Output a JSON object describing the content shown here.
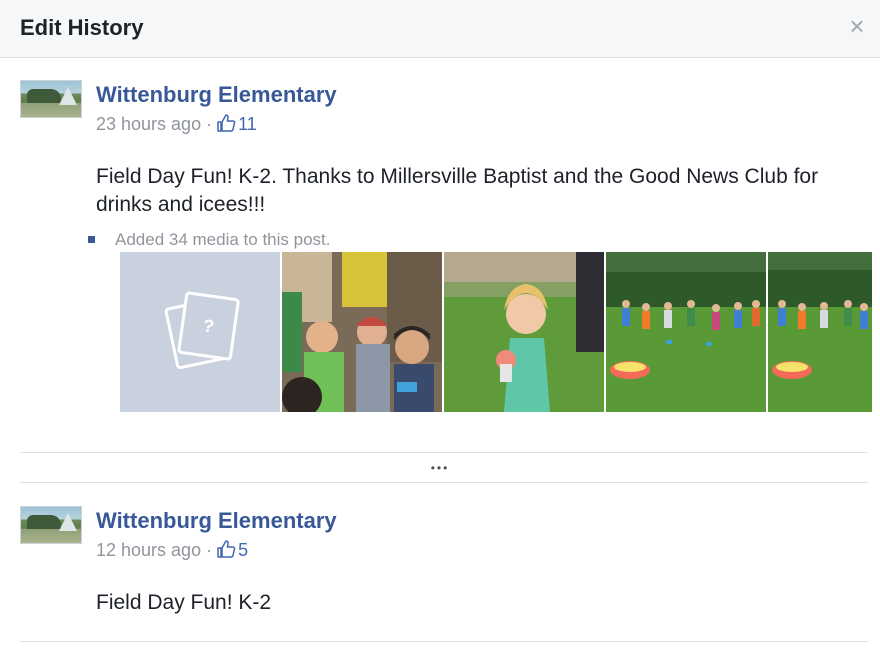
{
  "dialog": {
    "title": "Edit History",
    "close_icon": "close-icon"
  },
  "revisions": [
    {
      "author": "Wittenburg Elementary",
      "time": "23 hours ago",
      "separator": "·",
      "likes": "11",
      "text": "Field Day Fun! K-2. Thanks to Millersville Baptist and the Good News Club for drinks and icees!!!",
      "media_note": "Added 34 media to this post."
    },
    {
      "author": "Wittenburg Elementary",
      "time": "12 hours ago",
      "separator": "·",
      "likes": "5",
      "text": "Field Day Fun! K-2"
    }
  ],
  "more_indicator": "•••",
  "colors": {
    "link_blue": "#385898",
    "like_blue": "#4267b2",
    "meta_gray": "#90949c",
    "header_bg": "#f6f7f9",
    "placeholder_bg": "#c9d0de"
  }
}
